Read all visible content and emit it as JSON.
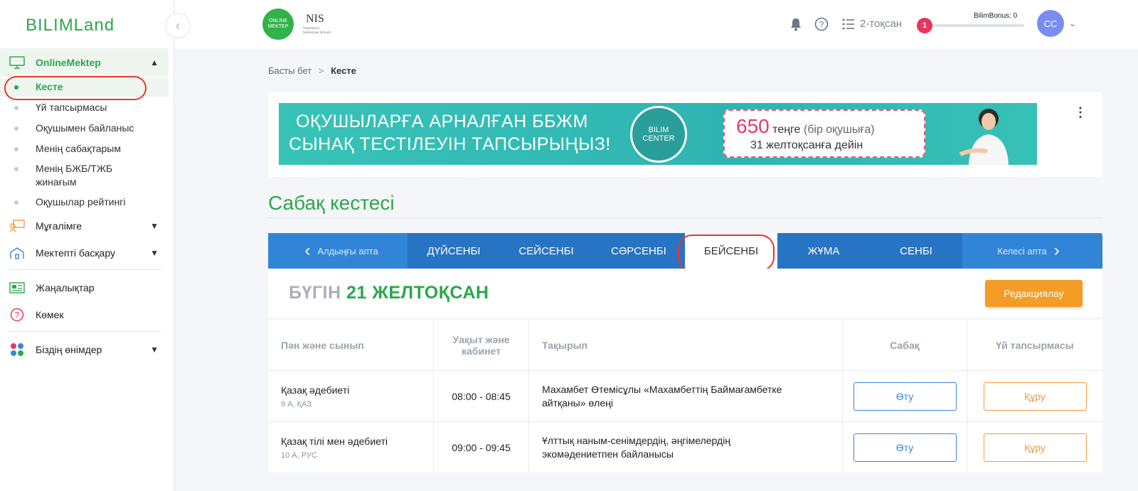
{
  "sidebar": {
    "logo": "BILIMLand",
    "groups": [
      {
        "label": "OnlineMektep",
        "icon": "monitor-icon"
      },
      {
        "label": "Мұғалімге",
        "icon": "teacher-icon"
      },
      {
        "label": "Мектепті басқару",
        "icon": "school-icon"
      },
      {
        "label": "Жаңалықтар",
        "icon": "news-icon"
      },
      {
        "label": "Көмек",
        "icon": "help-icon"
      },
      {
        "label": "Біздің өнімдер",
        "icon": "products-icon"
      }
    ],
    "sub_items": [
      {
        "label": "Кесте"
      },
      {
        "label": "Үй тапсырмасы"
      },
      {
        "label": "Оқушымен байланыс"
      },
      {
        "label": "Менің сабақтарым"
      },
      {
        "label": "Менің БЖБ/ТЖБ жинағым"
      },
      {
        "label": "Оқушылар рейтингі"
      }
    ]
  },
  "header": {
    "online_mektep_logo": "ONLINE MEKTEP",
    "nis_logo": "NIS",
    "nis_logo_sub": "Nazarbayev Intellectual Schools",
    "quarter": "2-тоқсан",
    "bonus_count": "1",
    "bonus_label": "BilimBonus: 0",
    "avatar_initials": "СС"
  },
  "breadcrumb": {
    "home": "Басты бет",
    "sep": ">",
    "current": "Кесте"
  },
  "banner": {
    "line1": "ОҚУШЫЛАРҒА АРНАЛҒАН ББЖМ",
    "line2": "СЫНАҚ ТЕСТІЛЕУІН ТАПСЫРЫҢЫЗ!",
    "center_line1": "BILIM",
    "center_line2": "CENTER",
    "price_number": "650",
    "price_currency": "теңге",
    "price_note": "(бір оқушыға)",
    "deadline": "31 желтоқсанға дейін"
  },
  "schedule": {
    "title": "Сабақ кестесі",
    "prev_week": "Алдыңғы апта",
    "next_week": "Келесі апта",
    "days": [
      "ДҮЙСЕНБІ",
      "СЕЙСЕНБІ",
      "СӘРСЕНБІ",
      "БЕЙСЕНБІ",
      "ЖҰМА",
      "СЕНБІ"
    ],
    "active_day": "БЕЙСЕНБІ",
    "today_prefix": "БҮГІН",
    "today_date": "21 ЖЕЛТОҚСАН",
    "edit_button": "Редакциялау",
    "columns": [
      "Пән және сынып",
      "Уақыт және кабинет",
      "Тақырып",
      "Сабақ",
      "Үй тапсырмасы"
    ],
    "rows": [
      {
        "subject": "Қазақ әдебиеті",
        "class": "9 А, ҚАЗ",
        "time": "08:00 - 08:45",
        "topic": "Махамбет Өтемісұлы «Махамбеттің Баймағамбетке айтқаны» өлеңі",
        "lesson_btn": "Өту",
        "homework_btn": "Құру"
      },
      {
        "subject": "Қазақ тілі мен әдебиеті",
        "class": "10 А, РУС",
        "time": "09:00 - 09:45",
        "topic": "Ұлттық наным-сенімдердің, әңгімелердің экомәдениетпен байланысы",
        "lesson_btn": "Өту",
        "homework_btn": "Құру"
      }
    ]
  },
  "colors": {
    "brand_green": "#2aa84a",
    "nav_blue": "#2c7cd0",
    "edit_orange": "#f39c26",
    "highlight_red": "#e8362a"
  }
}
